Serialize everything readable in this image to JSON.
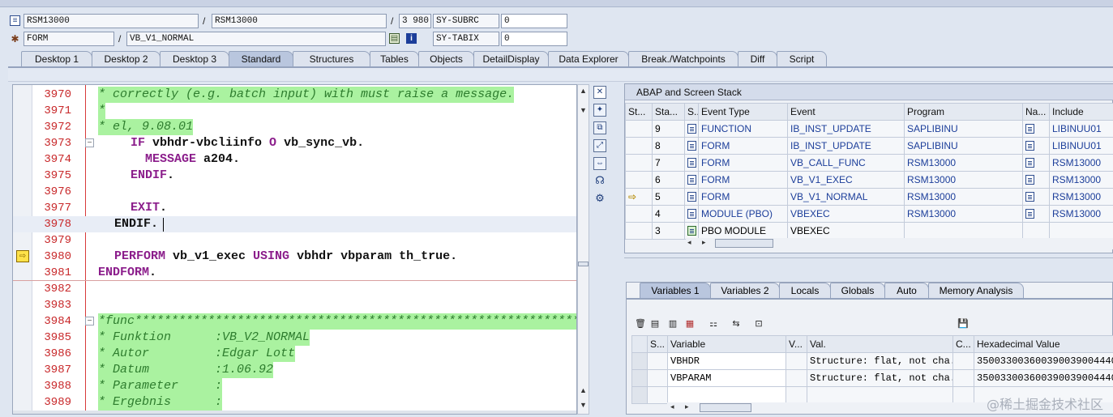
{
  "header": {
    "row1": {
      "program1": "RSM13000",
      "sep1": "/",
      "program2": "RSM13000",
      "sep2": "/",
      "line": "3 980",
      "sysfield": "SY-SUBRC",
      "sysvalue": "0"
    },
    "row2": {
      "type": "FORM",
      "sep1": "/",
      "name": "VB_V1_NORMAL",
      "sysfield": "SY-TABIX",
      "sysvalue": "0"
    }
  },
  "desktop_tabs": [
    "Desktop 1",
    "Desktop 2",
    "Desktop 3",
    "Standard",
    "Structures",
    "Tables",
    "Objects",
    "DetailDisplay",
    "Data Explorer",
    "Break./Watchpoints",
    "Diff",
    "Script"
  ],
  "active_tab": "Standard",
  "code": {
    "lines": [
      {
        "no": "3970",
        "text": "* correctly (e.g. batch input) with must raise a message."
      },
      {
        "no": "3971",
        "text": "*"
      },
      {
        "no": "3972",
        "text": "* el, 9.08.01"
      },
      {
        "no": "3973",
        "kw1": "IF",
        "rest1": " vbhdr-vbcliinfo ",
        "kw2": "O",
        "rest2": " vb_sync_vb."
      },
      {
        "no": "3974",
        "kw1": "MESSAGE",
        "rest1": " a204."
      },
      {
        "no": "3975",
        "kw1": "ENDIF",
        "rest1": "."
      },
      {
        "no": "3976",
        "text": ""
      },
      {
        "no": "3977",
        "kw1": "EXIT",
        "rest1": "."
      },
      {
        "no": "3978",
        "kw1": "ENDIF",
        "rest1": "."
      },
      {
        "no": "3979",
        "text": ""
      },
      {
        "no": "3980",
        "kw1": "PERFORM",
        "rest1": " vb_v1_exec ",
        "kw2": "USING",
        "rest2": " vbhdr vbparam th_true."
      },
      {
        "no": "3981",
        "kw1": "ENDFORM",
        "rest1": "."
      },
      {
        "no": "3982",
        "text": ""
      },
      {
        "no": "3983",
        "text": ""
      },
      {
        "no": "3984",
        "text": "*func*****************************************************************"
      },
      {
        "no": "3985",
        "text": "* Funktion      :VB_V2_NORMAL"
      },
      {
        "no": "3986",
        "text": "* Autor         :Edgar Lott"
      },
      {
        "no": "3987",
        "text": "* Datum         :1.06.92"
      },
      {
        "no": "3988",
        "text": "* Parameter     :"
      },
      {
        "no": "3989",
        "text": "* Ergebnis      :"
      }
    ]
  },
  "stack": {
    "title": "ABAP and Screen Stack",
    "columns": [
      "St...",
      "Sta...",
      "S...",
      "Event Type",
      "Event",
      "Program",
      "Na...",
      "Include"
    ],
    "rows": [
      {
        "cur": "",
        "level": "9",
        "type": "FUNCTION",
        "event": "IB_INST_UPDATE",
        "program": "SAPLIBINU",
        "include": "LIBINUU01"
      },
      {
        "cur": "",
        "level": "8",
        "type": "FORM",
        "event": "IB_INST_UPDATE",
        "program": "SAPLIBINU",
        "include": "LIBINUU01"
      },
      {
        "cur": "",
        "level": "7",
        "type": "FORM",
        "event": "VB_CALL_FUNC",
        "program": "RSM13000",
        "include": "RSM13000"
      },
      {
        "cur": "",
        "level": "6",
        "type": "FORM",
        "event": "VB_V1_EXEC",
        "program": "RSM13000",
        "include": "RSM13000"
      },
      {
        "cur": "⇨",
        "level": "5",
        "type": "FORM",
        "event": "VB_V1_NORMAL",
        "program": "RSM13000",
        "include": "RSM13000"
      },
      {
        "cur": "",
        "level": "4",
        "type": "MODULE (PBO)",
        "event": "VBEXEC",
        "program": "RSM13000",
        "include": "RSM13000"
      },
      {
        "cur": "",
        "level": "3",
        "type": "PBO MODULE",
        "event": "VBEXEC",
        "program": "",
        "include": ""
      }
    ]
  },
  "var_tabs": [
    "Variables 1",
    "Variables 2",
    "Locals",
    "Globals",
    "Auto",
    "Memory Analysis"
  ],
  "variables": {
    "columns": [
      "S...",
      "Variable",
      "V...",
      "Val.",
      "C...",
      "Hexadecimal Value"
    ],
    "rows": [
      {
        "name": "VBHDR",
        "value": "Structure: flat, not cha...",
        "hex": "3500330036003900390044400..."
      },
      {
        "name": "VBPARAM",
        "value": "Structure: flat, not cha...",
        "hex": "3500330036003900390044400..."
      }
    ]
  },
  "watermark": "@稀土掘金技术社区",
  "colors": {
    "comment_bg": "#aaf2a0",
    "keyword": "#8b1d8b",
    "line_no": "#c8282a",
    "link_blue": "#1c3e9a"
  }
}
